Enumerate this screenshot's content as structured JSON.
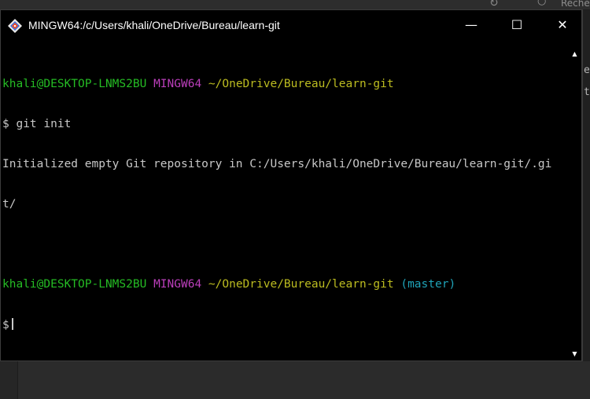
{
  "window": {
    "title": "MINGW64:/c/Users/khali/OneDrive/Bureau/learn-git",
    "icon": "git-bash-diamond-icon",
    "controls": {
      "minimize": "—",
      "maximize": "☐",
      "close": "✕"
    }
  },
  "background": {
    "search_text": "Reche",
    "right_text": [
      "e",
      "t"
    ]
  },
  "terminal": {
    "prompt1": {
      "user_host": "khali@DESKTOP-LNMS2BU",
      "env": "MINGW64",
      "path": "~/OneDrive/Bureau/learn-git"
    },
    "command1": "$ git init",
    "output1_line1": "Initialized empty Git repository in C:/Users/khali/OneDrive/Bureau/learn-git/.gi",
    "output1_line2": "t/",
    "prompt2": {
      "user_host": "khali@DESKTOP-LNMS2BU",
      "env": "MINGW64",
      "path": "~/OneDrive/Bureau/learn-git",
      "branch": "(master)"
    },
    "prompt_symbol": "$"
  },
  "colors": {
    "user_host": "#25bc24",
    "env": "#bc3fbc",
    "path": "#bcbc20",
    "branch": "#1fa3b8",
    "text": "#c0c0c0",
    "background": "#000000"
  }
}
